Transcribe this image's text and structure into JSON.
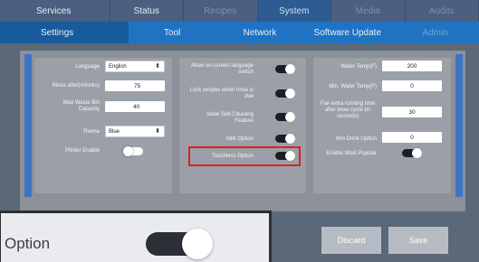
{
  "nav_primary": [
    {
      "label": "Services",
      "state": "normal"
    },
    {
      "label": "Status",
      "state": "normal"
    },
    {
      "label": "Recipes",
      "state": "disabled"
    },
    {
      "label": "System",
      "state": "active"
    },
    {
      "label": "Media",
      "state": "disabled"
    },
    {
      "label": "Audits",
      "state": "disabled"
    }
  ],
  "nav_secondary": [
    {
      "label": "Settings",
      "state": "active"
    },
    {
      "label": "Tool",
      "state": "normal"
    },
    {
      "label": "Network",
      "state": "normal"
    },
    {
      "label": "Software Update",
      "state": "normal"
    },
    {
      "label": "Admin",
      "state": "disabled"
    }
  ],
  "panel1": {
    "language_label": "Language",
    "language_value": "English",
    "rinse_label": "Rinse after(#drinks)",
    "rinse_value": "75",
    "waste_label_1": "Max Waste Bin",
    "waste_label_2": "Capacity",
    "waste_value": "40",
    "theme_label": "Theme",
    "theme_value": "Blue",
    "printer_label": "Printer Enable",
    "printer_on": false
  },
  "panel2": {
    "lang_switch_label_1": "Allow on-screen language",
    "lang_switch_label_2": "switch",
    "lock_label_1": "Lock recipes when rinse is",
    "lock_label_2": "due",
    "valve_label_1": "Valve Self-Cleaning",
    "valve_label_2": "Feature",
    "milk_label": "Milk Option",
    "touchless_label": "Touchless Option"
  },
  "panel3": {
    "water_temp_label": "Water Temp(F)",
    "water_temp_value": "200",
    "min_water_label": "Min. Water Temp(F)",
    "min_water_value": "0",
    "fan_label_1": "Fan extra running time",
    "fan_label_2": "after brew cycle (in",
    "fan_label_3": "seconds)",
    "fan_value": "30",
    "win_drink_label": "Win Drink Option",
    "win_drink_value": "0",
    "most_popular_label": "Enable Most Popular"
  },
  "buttons": {
    "discard": "Discard",
    "save": "Save"
  },
  "zoom": {
    "label": "Option"
  },
  "colors": {
    "highlight": "#e01f1f",
    "nav_active": "#2d5c92",
    "accent": "#1f73c2"
  }
}
